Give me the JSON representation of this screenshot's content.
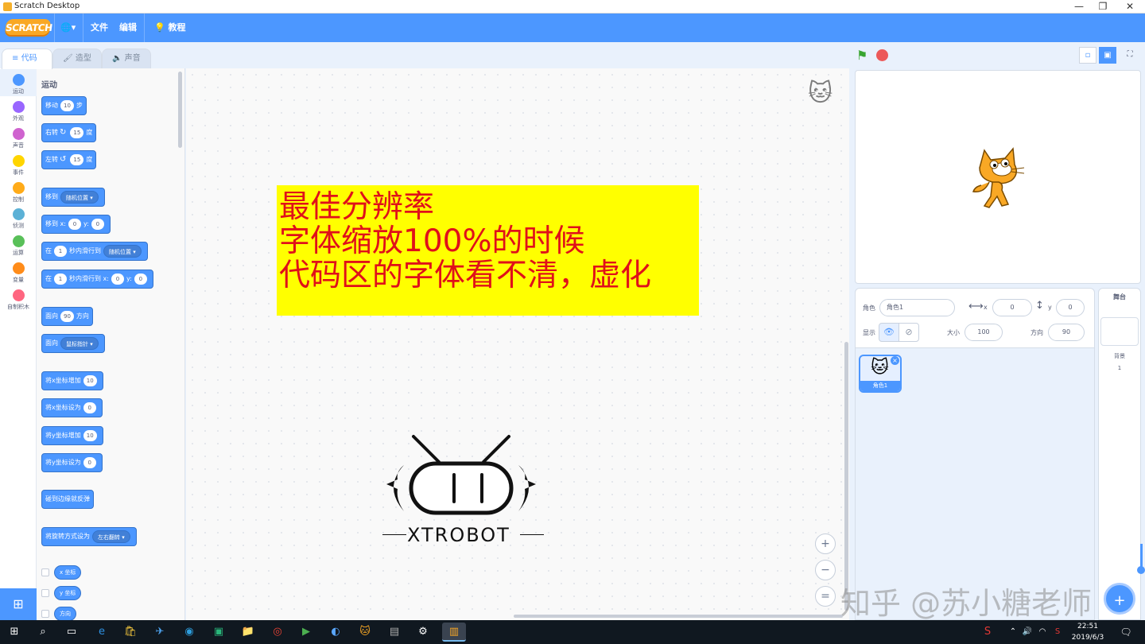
{
  "window": {
    "title": "Scratch Desktop",
    "controls": [
      "—",
      "❐",
      "✕"
    ]
  },
  "menubar": {
    "logo": "SCRATCH",
    "language_icon": "🌐▾",
    "file": "文件",
    "edit": "编辑",
    "tutorials": "教程"
  },
  "tabs": [
    {
      "label": "代码",
      "icon": "≡"
    },
    {
      "label": "造型",
      "icon": "🖌"
    },
    {
      "label": "声音",
      "icon": "🔈"
    }
  ],
  "categories": [
    {
      "label": "运动",
      "color": "#4c97ff"
    },
    {
      "label": "外观",
      "color": "#9966ff"
    },
    {
      "label": "声音",
      "color": "#cf63cf"
    },
    {
      "label": "事件",
      "color": "#ffd500"
    },
    {
      "label": "控制",
      "color": "#ffab19"
    },
    {
      "label": "侦测",
      "color": "#5cb1d6"
    },
    {
      "label": "运算",
      "color": "#59c059"
    },
    {
      "label": "变量",
      "color": "#ff8c1a"
    },
    {
      "label": "自制积木",
      "color": "#ff6680"
    }
  ],
  "palette": {
    "section_title": "运动",
    "move": {
      "pre": "移动",
      "val": "10",
      "post": "步"
    },
    "turn_right": {
      "pre": "右转",
      "icon": "↻",
      "val": "15",
      "post": "度"
    },
    "turn_left": {
      "pre": "左转",
      "icon": "↺",
      "val": "15",
      "post": "度"
    },
    "goto": {
      "pre": "移到",
      "dd": "随机位置 ▾"
    },
    "goto_xy": {
      "pre": "移到 x:",
      "x": "0",
      "ymid": "y:",
      "y": "0"
    },
    "glide": {
      "pre": "在",
      "val": "1",
      "mid": "秒内滑行到",
      "dd": "随机位置 ▾"
    },
    "glide_xy": {
      "pre": "在",
      "val": "1",
      "mid": "秒内滑行到 x:",
      "x": "0",
      "ymid": "y:",
      "y": "0"
    },
    "point_dir": {
      "pre": "面向",
      "val": "90",
      "post": "方向"
    },
    "point_towards": {
      "pre": "面向",
      "dd": "鼠标指针 ▾"
    },
    "change_x": {
      "pre": "将x坐标增加",
      "val": "10"
    },
    "set_x": {
      "pre": "将x坐标设为",
      "val": "0"
    },
    "change_y": {
      "pre": "将y坐标增加",
      "val": "10"
    },
    "set_y": {
      "pre": "将y坐标设为",
      "val": "0"
    },
    "bounce": {
      "pre": "碰到边缘就反弹"
    },
    "rotation": {
      "pre": "将旋转方式设为",
      "dd": "左右翻转 ▾"
    },
    "reporters": [
      "x 坐标",
      "y 坐标",
      "方向"
    ]
  },
  "notice": {
    "lines": [
      "最佳分辨率",
      "字体缩放100%的时候",
      "代码区的字体看不清，虚化"
    ]
  },
  "logo_text": "XTROBOT",
  "zoom": {
    "in": "+",
    "out": "−",
    "reset": "="
  },
  "stage_controls": {
    "flag": "⚑",
    "small": "▫",
    "normal": "▣",
    "full": "⛶"
  },
  "sprite_info": {
    "sprite_label": "角色",
    "sprite_name": "角色1",
    "x_label": "x",
    "x": "0",
    "y_label": "y",
    "y": "0",
    "show_label": "显示",
    "size_label": "大小",
    "size": "100",
    "dir_label": "方向",
    "direction": "90"
  },
  "sprites": [
    {
      "name": "角色1"
    }
  ],
  "stage_panel": {
    "title": "舞台",
    "backdrop_label": "背景",
    "backdrop_count": "1"
  },
  "watermark": "知乎 @苏小糖老师",
  "taskbar": {
    "time": "22:51",
    "date": "2019/6/3"
  }
}
